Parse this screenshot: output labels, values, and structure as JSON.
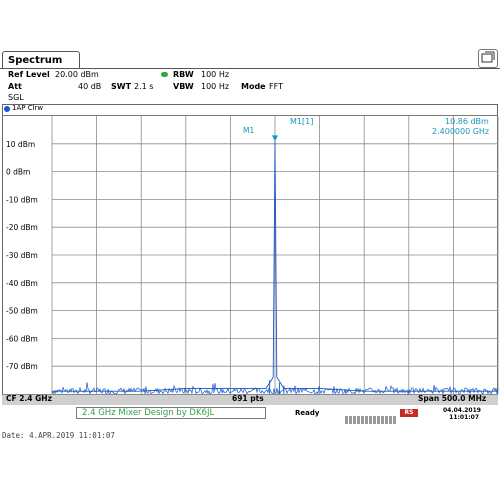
{
  "tab": {
    "title": "Spectrum"
  },
  "settings": {
    "ref_level_label": "Ref Level",
    "ref_level_value": "20.00 dBm",
    "att_label": "Att",
    "att_value": "40 dB",
    "swt_label": "SWT",
    "swt_value": "2.1 s",
    "sgl": "SGL",
    "rbw_label": "RBW",
    "rbw_value": "100 Hz",
    "vbw_label": "VBW",
    "vbw_value": "100 Hz",
    "mode_label": "Mode",
    "mode_value": "FFT"
  },
  "trace": {
    "label": "1AP Clrw",
    "color": "#1a56c4"
  },
  "marker": {
    "name": "M1",
    "header": "M1[1]",
    "level": "10.86 dBm",
    "freq": "2.400000 GHz",
    "color": "#1797b8"
  },
  "chart_data": {
    "type": "line",
    "title": "",
    "xlabel": "",
    "ylabel": "",
    "x_unit": "GHz",
    "xlim": [
      2.15,
      2.65
    ],
    "ylim": [
      -80,
      20
    ],
    "grid": true,
    "y_ticks": [
      "10 dBm",
      "0 dBm",
      "-10 dBm",
      "-20 dBm",
      "-30 dBm",
      "-40 dBm",
      "-50 dBm",
      "-60 dBm",
      "-70 dBm"
    ],
    "y_tick_values": [
      10,
      0,
      -10,
      -20,
      -30,
      -40,
      -50,
      -60,
      -70
    ],
    "series": [
      {
        "values": [
          [
            2.15,
            -79
          ],
          [
            2.2,
            -79
          ],
          [
            2.25,
            -79
          ],
          [
            2.3,
            -78
          ],
          [
            2.35,
            -78
          ],
          [
            2.39,
            -78
          ],
          [
            2.398,
            -74
          ],
          [
            2.4,
            10.86
          ],
          [
            2.402,
            -74
          ],
          [
            2.41,
            -78
          ],
          [
            2.45,
            -78
          ],
          [
            2.5,
            -79
          ],
          [
            2.55,
            -79
          ],
          [
            2.6,
            -79
          ],
          [
            2.65,
            -79
          ]
        ]
      }
    ]
  },
  "bottom_bar": {
    "cf": "CF 2.4 GHz",
    "points": "691 pts",
    "span": "Span 500.0 MHz"
  },
  "status": {
    "message": "2.4 GHz Mixer   Design by DK6JL",
    "ready": "Ready",
    "logo": "RS",
    "date_line1": "04.04.2019",
    "date_line2": "11:01:07"
  },
  "footer": {
    "date": "Date: 4.APR.2019  11:01:07"
  }
}
